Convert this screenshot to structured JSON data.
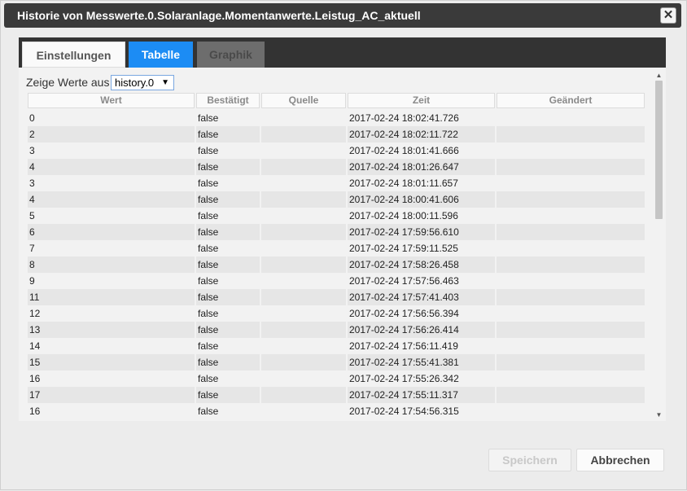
{
  "window": {
    "title": "Historie von Messwerte.0.Solaranlage.Momentanwerte.Leistug_AC_aktuell"
  },
  "tabs": [
    {
      "label": "Einstellungen"
    },
    {
      "label": "Tabelle"
    },
    {
      "label": "Graphik"
    }
  ],
  "filter": {
    "label": "Zeige Werte aus",
    "selected": "history.0"
  },
  "table": {
    "columns": [
      "Wert",
      "Bestätigt",
      "Quelle",
      "Zeit",
      "Geändert"
    ],
    "rows": [
      [
        "0",
        "false",
        "",
        "2017-02-24 18:02:41.726",
        ""
      ],
      [
        "2",
        "false",
        "",
        "2017-02-24 18:02:11.722",
        ""
      ],
      [
        "3",
        "false",
        "",
        "2017-02-24 18:01:41.666",
        ""
      ],
      [
        "4",
        "false",
        "",
        "2017-02-24 18:01:26.647",
        ""
      ],
      [
        "3",
        "false",
        "",
        "2017-02-24 18:01:11.657",
        ""
      ],
      [
        "4",
        "false",
        "",
        "2017-02-24 18:00:41.606",
        ""
      ],
      [
        "5",
        "false",
        "",
        "2017-02-24 18:00:11.596",
        ""
      ],
      [
        "6",
        "false",
        "",
        "2017-02-24 17:59:56.610",
        ""
      ],
      [
        "7",
        "false",
        "",
        "2017-02-24 17:59:11.525",
        ""
      ],
      [
        "8",
        "false",
        "",
        "2017-02-24 17:58:26.458",
        ""
      ],
      [
        "9",
        "false",
        "",
        "2017-02-24 17:57:56.463",
        ""
      ],
      [
        "11",
        "false",
        "",
        "2017-02-24 17:57:41.403",
        ""
      ],
      [
        "12",
        "false",
        "",
        "2017-02-24 17:56:56.394",
        ""
      ],
      [
        "13",
        "false",
        "",
        "2017-02-24 17:56:26.414",
        ""
      ],
      [
        "14",
        "false",
        "",
        "2017-02-24 17:56:11.419",
        ""
      ],
      [
        "15",
        "false",
        "",
        "2017-02-24 17:55:41.381",
        ""
      ],
      [
        "16",
        "false",
        "",
        "2017-02-24 17:55:26.342",
        ""
      ],
      [
        "17",
        "false",
        "",
        "2017-02-24 17:55:11.317",
        ""
      ],
      [
        "16",
        "false",
        "",
        "2017-02-24 17:54:56.315",
        ""
      ]
    ]
  },
  "buttons": {
    "save": "Speichern",
    "cancel": "Abbrechen"
  },
  "icons": {
    "close": "close-icon",
    "dropdown": "chevron-down-icon"
  },
  "colors": {
    "active_tab": "#1c8cf4",
    "titlebar": "#3a3a3a"
  }
}
